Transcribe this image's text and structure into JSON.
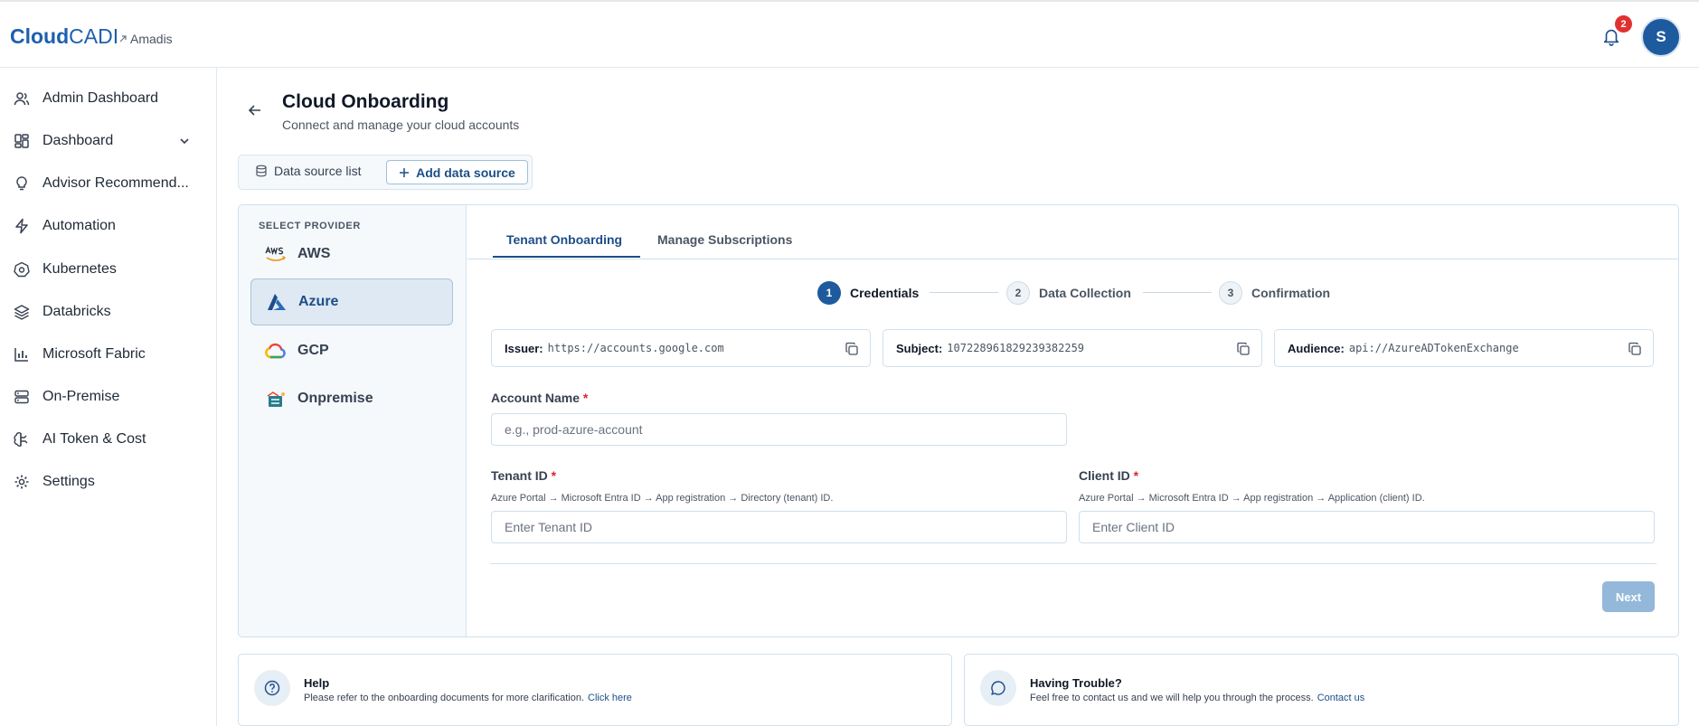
{
  "header": {
    "logo_bold": "Cloud",
    "logo_light": "CADI",
    "tenant": "Amadis",
    "notification_count": "2",
    "avatar_initial": "S"
  },
  "sidebar": {
    "items": [
      {
        "label": "Admin Dashboard",
        "icon": "users-icon"
      },
      {
        "label": "Dashboard",
        "icon": "dashboard-icon"
      },
      {
        "label": "Advisor Recommend...",
        "icon": "lightbulb-icon"
      },
      {
        "label": "Automation",
        "icon": "bolt-icon"
      },
      {
        "label": "Kubernetes",
        "icon": "kubernetes-icon"
      },
      {
        "label": "Databricks",
        "icon": "layers-icon"
      },
      {
        "label": "Microsoft Fabric",
        "icon": "bar-chart-icon"
      },
      {
        "label": "On-Premise",
        "icon": "server-icon"
      },
      {
        "label": "AI Token & Cost",
        "icon": "brain-icon"
      },
      {
        "label": "Settings",
        "icon": "gear-icon"
      }
    ]
  },
  "page": {
    "title": "Cloud Onboarding",
    "subtitle": "Connect and manage your cloud accounts"
  },
  "datasource_tabs": {
    "list_label": "Data source list",
    "add_label": "Add data source"
  },
  "providers": {
    "title": "SELECT PROVIDER",
    "items": [
      {
        "label": "AWS"
      },
      {
        "label": "Azure"
      },
      {
        "label": "GCP"
      },
      {
        "label": "Onpremise"
      }
    ],
    "selected": "Azure"
  },
  "tabs": [
    {
      "label": "Tenant Onboarding"
    },
    {
      "label": "Manage Subscriptions"
    }
  ],
  "steps": [
    {
      "num": "1",
      "label": "Credentials"
    },
    {
      "num": "2",
      "label": "Data Collection"
    },
    {
      "num": "3",
      "label": "Confirmation"
    }
  ],
  "info": {
    "issuer_key": "Issuer:",
    "issuer_value": "https://accounts.google.com",
    "subject_key": "Subject:",
    "subject_value": "107228961829239382259",
    "audience_key": "Audience:",
    "audience_value": "api://AzureADTokenExchange"
  },
  "form": {
    "account_name_label": "Account Name",
    "account_name_placeholder": "e.g., prod-azure-account",
    "tenant_id_label": "Tenant ID",
    "tenant_id_hint": "Azure Portal → Microsoft Entra ID → App registration → Directory (tenant) ID.",
    "tenant_id_placeholder": "Enter Tenant ID",
    "client_id_label": "Client ID",
    "client_id_hint": "Azure Portal → Microsoft Entra ID → App registration → Application (client) ID.",
    "client_id_placeholder": "Enter Client ID",
    "required_mark": "*",
    "next_label": "Next"
  },
  "help": {
    "title": "Help",
    "text": "Please refer to the onboarding documents for more clarification.",
    "link": "Click here"
  },
  "trouble": {
    "title": "Having Trouble?",
    "text": "Feel free to contact us and we will help you through the process.",
    "link": "Contact us"
  },
  "colors": {
    "brand": "#1e5fae",
    "accent": "#1d4e89",
    "badge": "#e03131",
    "disabled_button": "#93b8d9"
  }
}
